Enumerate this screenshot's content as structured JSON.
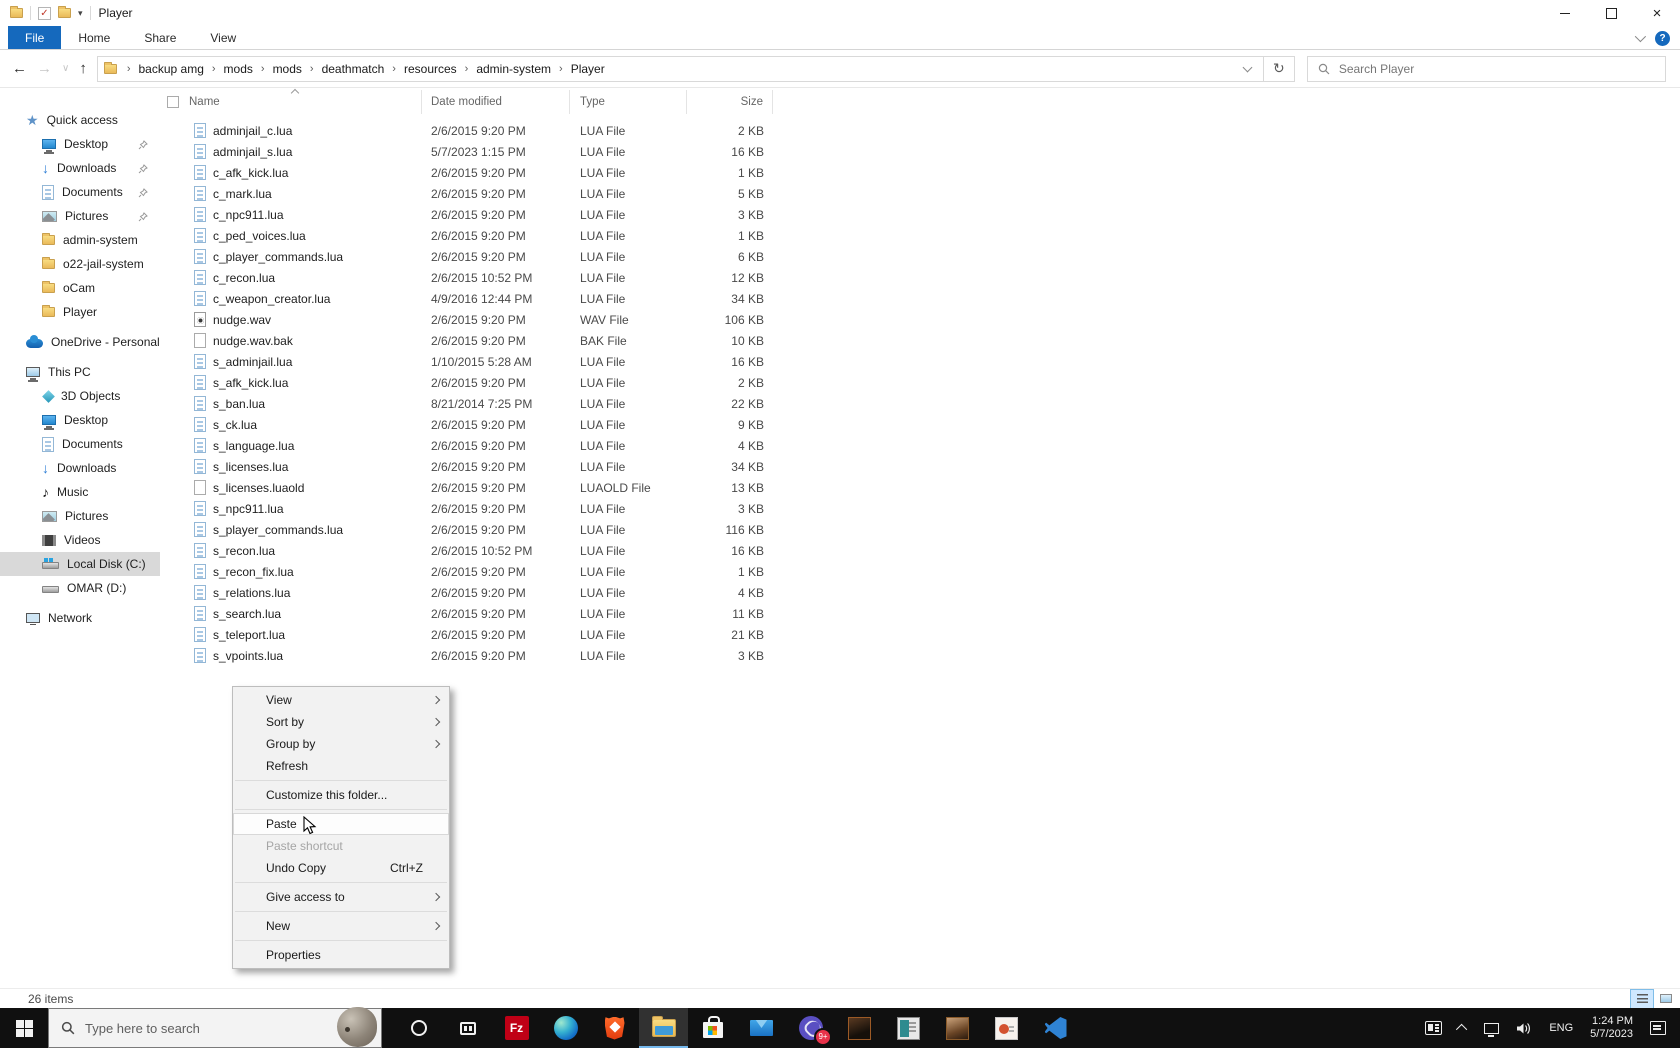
{
  "colors": {
    "accent": "#1569bd",
    "folder_yellow": "#f0c04e",
    "taskbar_bg": "#101010",
    "menu_hover": "#fdfdfd"
  },
  "window": {
    "title": "Player",
    "qat_icons": [
      "folder-icon",
      "properties-check-icon",
      "new-folder-icon",
      "customize-qat-chevron"
    ],
    "controls": [
      "minimize",
      "maximize",
      "close"
    ]
  },
  "ribbon": {
    "tabs": [
      {
        "label": "File",
        "active": true
      },
      {
        "label": "Home",
        "active": false
      },
      {
        "label": "Share",
        "active": false
      },
      {
        "label": "View",
        "active": false
      }
    ],
    "expand_chevron": "collapse-ribbon",
    "help": "?"
  },
  "address": {
    "breadcrumb": [
      "backup amg",
      "mods",
      "mods",
      "deathmatch",
      "resources",
      "admin-system",
      "Player"
    ]
  },
  "search": {
    "placeholder": "Search Player"
  },
  "columns": {
    "name": "Name",
    "date": "Date modified",
    "type": "Type",
    "size": "Size",
    "sorted_by": "Name",
    "sort_dir": "asc"
  },
  "files": [
    {
      "name": "adminjail_c.lua",
      "date": "2/6/2015 9:20 PM",
      "type": "LUA File",
      "size": "2 KB",
      "icon": "doc"
    },
    {
      "name": "adminjail_s.lua",
      "date": "5/7/2023 1:15 PM",
      "type": "LUA File",
      "size": "16 KB",
      "icon": "doc"
    },
    {
      "name": "c_afk_kick.lua",
      "date": "2/6/2015 9:20 PM",
      "type": "LUA File",
      "size": "1 KB",
      "icon": "doc"
    },
    {
      "name": "c_mark.lua",
      "date": "2/6/2015 9:20 PM",
      "type": "LUA File",
      "size": "5 KB",
      "icon": "doc"
    },
    {
      "name": "c_npc911.lua",
      "date": "2/6/2015 9:20 PM",
      "type": "LUA File",
      "size": "3 KB",
      "icon": "doc"
    },
    {
      "name": "c_ped_voices.lua",
      "date": "2/6/2015 9:20 PM",
      "type": "LUA File",
      "size": "1 KB",
      "icon": "doc"
    },
    {
      "name": "c_player_commands.lua",
      "date": "2/6/2015 9:20 PM",
      "type": "LUA File",
      "size": "6 KB",
      "icon": "doc"
    },
    {
      "name": "c_recon.lua",
      "date": "2/6/2015 10:52 PM",
      "type": "LUA File",
      "size": "12 KB",
      "icon": "doc"
    },
    {
      "name": "c_weapon_creator.lua",
      "date": "4/9/2016 12:44 PM",
      "type": "LUA File",
      "size": "34 KB",
      "icon": "doc"
    },
    {
      "name": "nudge.wav",
      "date": "2/6/2015 9:20 PM",
      "type": "WAV File",
      "size": "106 KB",
      "icon": "media"
    },
    {
      "name": "nudge.wav.bak",
      "date": "2/6/2015 9:20 PM",
      "type": "BAK File",
      "size": "10 KB",
      "icon": "blank"
    },
    {
      "name": "s_adminjail.lua",
      "date": "1/10/2015 5:28 AM",
      "type": "LUA File",
      "size": "16 KB",
      "icon": "doc"
    },
    {
      "name": "s_afk_kick.lua",
      "date": "2/6/2015 9:20 PM",
      "type": "LUA File",
      "size": "2 KB",
      "icon": "doc"
    },
    {
      "name": "s_ban.lua",
      "date": "8/21/2014 7:25 PM",
      "type": "LUA File",
      "size": "22 KB",
      "icon": "doc"
    },
    {
      "name": "s_ck.lua",
      "date": "2/6/2015 9:20 PM",
      "type": "LUA File",
      "size": "9 KB",
      "icon": "doc"
    },
    {
      "name": "s_language.lua",
      "date": "2/6/2015 9:20 PM",
      "type": "LUA File",
      "size": "4 KB",
      "icon": "doc"
    },
    {
      "name": "s_licenses.lua",
      "date": "2/6/2015 9:20 PM",
      "type": "LUA File",
      "size": "34 KB",
      "icon": "doc"
    },
    {
      "name": "s_licenses.luaold",
      "date": "2/6/2015 9:20 PM",
      "type": "LUAOLD File",
      "size": "13 KB",
      "icon": "blank"
    },
    {
      "name": "s_npc911.lua",
      "date": "2/6/2015 9:20 PM",
      "type": "LUA File",
      "size": "3 KB",
      "icon": "doc"
    },
    {
      "name": "s_player_commands.lua",
      "date": "2/6/2015 9:20 PM",
      "type": "LUA File",
      "size": "116 KB",
      "icon": "doc"
    },
    {
      "name": "s_recon.lua",
      "date": "2/6/2015 10:52 PM",
      "type": "LUA File",
      "size": "16 KB",
      "icon": "doc"
    },
    {
      "name": "s_recon_fix.lua",
      "date": "2/6/2015 9:20 PM",
      "type": "LUA File",
      "size": "1 KB",
      "icon": "doc"
    },
    {
      "name": "s_relations.lua",
      "date": "2/6/2015 9:20 PM",
      "type": "LUA File",
      "size": "4 KB",
      "icon": "doc"
    },
    {
      "name": "s_search.lua",
      "date": "2/6/2015 9:20 PM",
      "type": "LUA File",
      "size": "11 KB",
      "icon": "doc"
    },
    {
      "name": "s_teleport.lua",
      "date": "2/6/2015 9:20 PM",
      "type": "LUA File",
      "size": "21 KB",
      "icon": "doc"
    },
    {
      "name": "s_vpoints.lua",
      "date": "2/6/2015 9:20 PM",
      "type": "LUA File",
      "size": "3 KB",
      "icon": "doc"
    }
  ],
  "sidebar": {
    "sections": [
      {
        "label": "Quick access",
        "icon": "star",
        "items": [
          {
            "label": "Desktop",
            "icon": "desktop",
            "pinned": true
          },
          {
            "label": "Downloads",
            "icon": "download",
            "pinned": true
          },
          {
            "label": "Documents",
            "icon": "document",
            "pinned": true
          },
          {
            "label": "Pictures",
            "icon": "pictures",
            "pinned": true
          },
          {
            "label": "admin-system",
            "icon": "folder"
          },
          {
            "label": "o22-jail-system",
            "icon": "folder"
          },
          {
            "label": "oCam",
            "icon": "folder"
          },
          {
            "label": "Player",
            "icon": "folder"
          }
        ]
      },
      {
        "label": "OneDrive - Personal",
        "icon": "onedrive",
        "items": []
      },
      {
        "label": "This PC",
        "icon": "pc",
        "items": [
          {
            "label": "3D Objects",
            "icon": "cube"
          },
          {
            "label": "Desktop",
            "icon": "desktop"
          },
          {
            "label": "Documents",
            "icon": "document"
          },
          {
            "label": "Downloads",
            "icon": "download"
          },
          {
            "label": "Music",
            "icon": "music"
          },
          {
            "label": "Pictures",
            "icon": "pictures"
          },
          {
            "label": "Videos",
            "icon": "videos"
          },
          {
            "label": "Local Disk (C:)",
            "icon": "drive-c",
            "selected": true
          },
          {
            "label": "OMAR (D:)",
            "icon": "drive"
          }
        ]
      },
      {
        "label": "Network",
        "icon": "network",
        "items": []
      }
    ]
  },
  "context_menu": {
    "items": [
      {
        "label": "View",
        "submenu": true
      },
      {
        "label": "Sort by",
        "submenu": true
      },
      {
        "label": "Group by",
        "submenu": true
      },
      {
        "label": "Refresh"
      },
      {
        "type": "sep"
      },
      {
        "label": "Customize this folder..."
      },
      {
        "type": "sep"
      },
      {
        "label": "Paste",
        "hover": true
      },
      {
        "label": "Paste shortcut",
        "disabled": true
      },
      {
        "label": "Undo Copy",
        "shortcut": "Ctrl+Z"
      },
      {
        "type": "sep"
      },
      {
        "label": "Give access to",
        "submenu": true
      },
      {
        "type": "sep"
      },
      {
        "label": "New",
        "submenu": true
      },
      {
        "type": "sep"
      },
      {
        "label": "Properties"
      }
    ]
  },
  "status_bar": {
    "items_count": "26 items",
    "view_modes": [
      "details-view",
      "large-icons-view"
    ]
  },
  "taskbar": {
    "search_placeholder": "Type here to search",
    "icons": [
      {
        "name": "cortana"
      },
      {
        "name": "task-view"
      },
      {
        "name": "filezilla",
        "label": "Fz"
      },
      {
        "name": "edge"
      },
      {
        "name": "brave"
      },
      {
        "name": "file-explorer",
        "active": true
      },
      {
        "name": "microsoft-store"
      },
      {
        "name": "mail"
      },
      {
        "name": "xbox",
        "badge": "9+"
      },
      {
        "name": "app-photo-dark"
      },
      {
        "name": "app-teal-window"
      },
      {
        "name": "app-photo"
      },
      {
        "name": "app-powerpoint"
      },
      {
        "name": "vscode"
      }
    ],
    "tray": {
      "lang": "ENG",
      "time": "1:24 PM",
      "date": "5/7/2023"
    }
  }
}
